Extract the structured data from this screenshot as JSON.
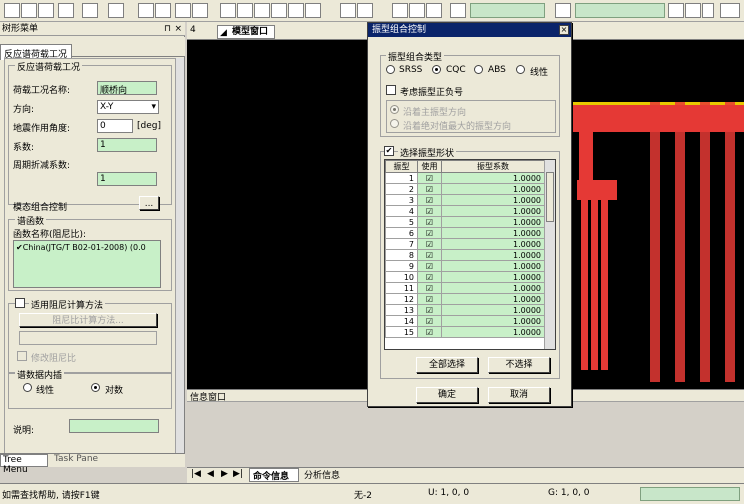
{
  "toolbar": {
    "icons": [
      "undo-icon",
      "redo-icon",
      "print-icon",
      "zoom-icon"
    ]
  },
  "left_panel": {
    "title": "树形菜单",
    "tab": "反应谱荷载工况",
    "group_title": "反应谱荷载工况",
    "load_case_label": "荷载工况名称:",
    "load_case_value": "顺桥向",
    "direction_label": "方向:",
    "direction_value": "X-Y",
    "angle_label": "地震作用角度:",
    "angle_value": "0",
    "angle_unit": "[deg]",
    "factor_label": "系数:",
    "factor_value": "1",
    "period_label": "周期折减系数:",
    "period_value": "1",
    "mode_label": "模态组合控制",
    "mode_btn": "...",
    "spectrum_group": "谱函数",
    "spectrum_name_label": "函数名称(阻尼比):",
    "spectrum_item": "China(JTG/T B02-01-2008) (0.0",
    "damping_check": "适用阻尼计算方法",
    "damping_btn": "阻尼比计算方法...",
    "modify_damping": "修改阻尼比",
    "interp_group": "谱数据内插",
    "interp_linear": "线性",
    "interp_log": "对数",
    "desc_label": "说明:",
    "tab_tree": "Tree Menu",
    "tab_task": "Task Pane"
  },
  "doc": {
    "tab": "模型窗口",
    "info_title": "信息窗口",
    "tab_cmd": "命令信息",
    "tab_analysis": "分析信息"
  },
  "status": {
    "help": "如需查找帮助, 请按F1键",
    "node": "无-2",
    "u": "U: 1, 0, 0",
    "g": "G: 1, 0, 0"
  },
  "dialog": {
    "title": "振型组合控制",
    "close": "×",
    "comb_group": "振型组合类型",
    "opt_srss": "SRSS",
    "opt_cqc": "CQC",
    "opt_abs": "ABS",
    "opt_linear": "线性",
    "sign_check": "考虑振型正负号",
    "sign_opt1": "沿着主振型方向",
    "sign_opt2": "沿着绝对值最大的振型方向",
    "select_check": "选择振型形状",
    "col_mode": "振型",
    "col_use": "使用",
    "col_coef": "振型系数",
    "rows": [
      {
        "mode": "1",
        "coef": "1.0000"
      },
      {
        "mode": "2",
        "coef": "1.0000"
      },
      {
        "mode": "3",
        "coef": "1.0000"
      },
      {
        "mode": "4",
        "coef": "1.0000"
      },
      {
        "mode": "5",
        "coef": "1.0000"
      },
      {
        "mode": "6",
        "coef": "1.0000"
      },
      {
        "mode": "7",
        "coef": "1.0000"
      },
      {
        "mode": "8",
        "coef": "1.0000"
      },
      {
        "mode": "9",
        "coef": "1.0000"
      },
      {
        "mode": "10",
        "coef": "1.0000"
      },
      {
        "mode": "11",
        "coef": "1.0000"
      },
      {
        "mode": "12",
        "coef": "1.0000"
      },
      {
        "mode": "13",
        "coef": "1.0000"
      },
      {
        "mode": "14",
        "coef": "1.0000"
      },
      {
        "mode": "15",
        "coef": "1.0000"
      }
    ],
    "select_all": "全部选择",
    "deselect": "不选择",
    "ok": "确定",
    "cancel": "取消"
  }
}
